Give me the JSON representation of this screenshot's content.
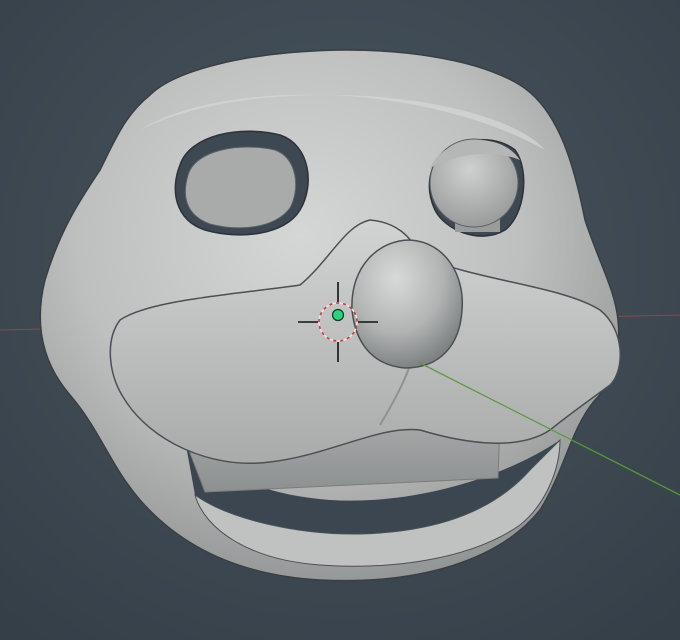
{
  "viewport": {
    "mode": "3d-viewport",
    "background_top": "#4a5660",
    "background_bottom": "#353f48"
  },
  "axes": {
    "x_axis_color": "#9a4a52",
    "y_axis_color": "#5a9a3a"
  },
  "model": {
    "object": "character-head-mask",
    "shading": "solid",
    "base_color": "#c7c8c8",
    "shadow_color": "#8e9090",
    "rim_color": "#3a3f44"
  },
  "cursor_3d": {
    "ring_color_a": "#e6e6e6",
    "ring_color_b": "#d23a3a",
    "crosshair_color": "#111111"
  },
  "origin": {
    "color": "#2fd17a"
  },
  "icons": {
    "cursor": "3d-cursor-icon",
    "origin": "object-origin-icon"
  }
}
